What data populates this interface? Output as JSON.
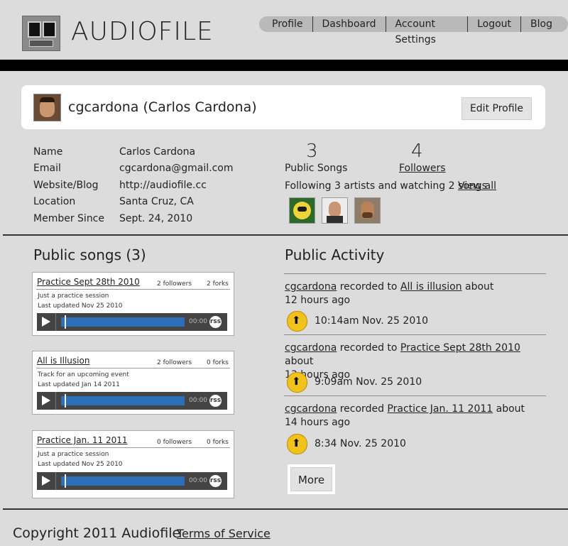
{
  "header": {
    "app_title": "AUDIOFILE",
    "nav": [
      "Profile",
      "Dashboard",
      "Account Settings",
      "Logout",
      "Blog"
    ]
  },
  "profile": {
    "display_name": "cgcardona (Carlos Cardona)",
    "edit_label": "Edit Profile",
    "details": [
      {
        "label": "Name",
        "value": "Carlos Cardona"
      },
      {
        "label": "Email",
        "value": "cgcardona@gmail.com"
      },
      {
        "label": "Website/Blog",
        "value": "http://audiofile.cc"
      },
      {
        "label": "Location",
        "value": "Santa Cruz, CA"
      },
      {
        "label": "Member Since",
        "value": "Sept. 24, 2010"
      }
    ],
    "stats": {
      "public_songs_count": "3",
      "public_songs_label": "Public Songs",
      "followers_count": "4",
      "followers_label": "Followers"
    },
    "following_text": "Following 3 artists and watching 2 songs",
    "view_all_label": "View all"
  },
  "songs": {
    "section_title": "Public songs (3)",
    "items": [
      {
        "title": "Practice Sept 28th 2010",
        "followers": "2 followers",
        "forks": "2 forks",
        "description": "Just a practice session",
        "updated": "Last updated Nov 25 2010",
        "time": "00:00",
        "rss": "rss"
      },
      {
        "title": "All is Illusion",
        "followers": "2 followers",
        "forks": "0 forks",
        "description": "Track for an upcoming event",
        "updated": "Last updated Jan 14 2011",
        "time": "00:00",
        "rss": "rss"
      },
      {
        "title": "Practice Jan. 11 2011",
        "followers": "0 followers",
        "forks": "0 forks",
        "description": "Just a practice session",
        "updated": "Last updated Nov 25 2010",
        "time": "00:00",
        "rss": "rss"
      }
    ]
  },
  "activity": {
    "section_title": "Public Activity",
    "items": [
      {
        "user": "cgcardona",
        "verb": "recorded to",
        "song": "All is illusion",
        "suffix": "about",
        "ago": "12 hours ago",
        "timestamp": "10:14am Nov. 25 2010"
      },
      {
        "user": "cgcardona",
        "verb": "recorded to",
        "song": "Practice Sept 28th 2010",
        "suffix": "about",
        "ago": "13 hours ago",
        "timestamp": "9:09am Nov. 25 2010"
      },
      {
        "user": "cgcardona",
        "verb": "recorded",
        "song": "Practice Jan. 11 2011",
        "suffix": "about",
        "ago": "14 hours ago",
        "timestamp": "8:34 Nov. 25 2010"
      }
    ],
    "more_label": "More"
  },
  "footer": {
    "copyright": "Copyright 2011 Audiofile",
    "terms_label": "Terms of Service"
  }
}
